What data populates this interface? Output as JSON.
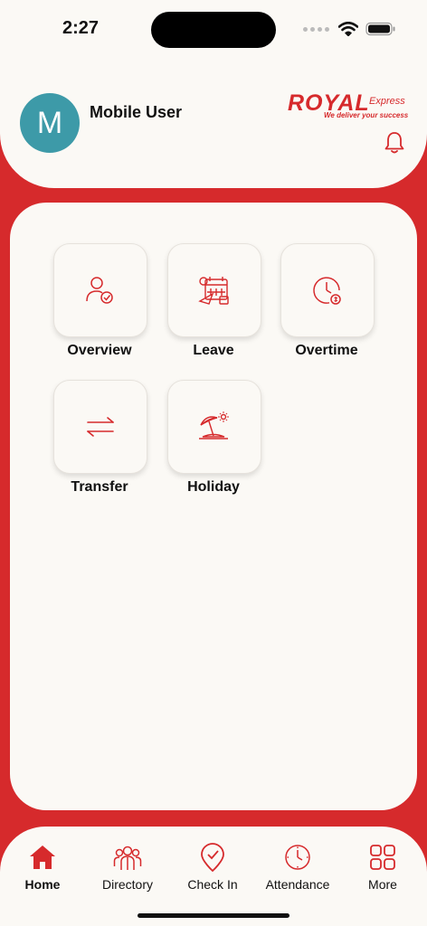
{
  "status": {
    "time": "2:27"
  },
  "user": {
    "initial": "M",
    "name": "Mobile User"
  },
  "brand": {
    "main": "ROYAL",
    "sub": "Express",
    "tagline": "We deliver your success",
    "color": "#d62a2c"
  },
  "menu": [
    {
      "label": "Overview",
      "icon": "user-check-icon"
    },
    {
      "label": "Leave",
      "icon": "calendar-plane-icon"
    },
    {
      "label": "Overtime",
      "icon": "clock-dollar-icon"
    },
    {
      "label": "Transfer",
      "icon": "transfer-arrows-icon"
    },
    {
      "label": "Holiday",
      "icon": "beach-umbrella-icon"
    }
  ],
  "nav": [
    {
      "label": "Home",
      "icon": "home-icon",
      "active": true
    },
    {
      "label": "Directory",
      "icon": "people-icon",
      "active": false
    },
    {
      "label": "Check In",
      "icon": "location-check-icon",
      "active": false
    },
    {
      "label": "Attendance",
      "icon": "clock-icon",
      "active": false
    },
    {
      "label": "More",
      "icon": "grid-icon",
      "active": false
    }
  ]
}
